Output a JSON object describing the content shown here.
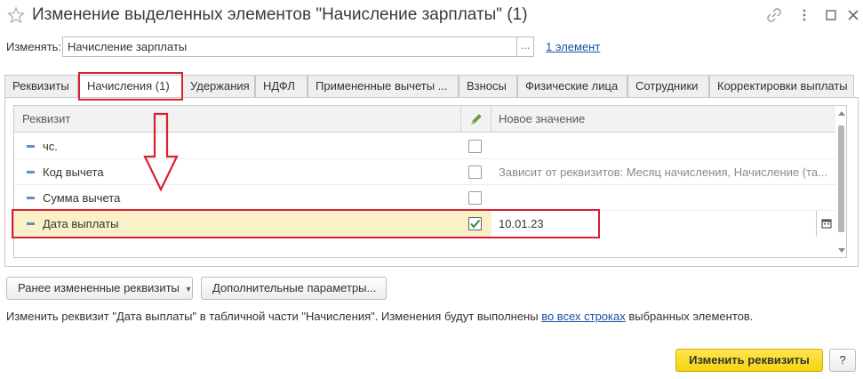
{
  "window": {
    "title": "Изменение выделенных элементов \"Начисление зарплаты\" (1)",
    "star_icon": "star-icon",
    "link_icon": "link-icon",
    "more_icon": "more-icon",
    "maximize_icon": "maximize-icon",
    "close_icon": "close-icon"
  },
  "change": {
    "label": "Изменять:",
    "value": "Начисление зарплаты",
    "select_label": "...",
    "elements_link": "1 элемент"
  },
  "tabs": [
    {
      "label": "Реквизиты"
    },
    {
      "label": "Начисления (1)"
    },
    {
      "label": "Удержания"
    },
    {
      "label": "НДФЛ"
    },
    {
      "label": "Примененные вычеты ..."
    },
    {
      "label": "Взносы"
    },
    {
      "label": "Физические лица"
    },
    {
      "label": "Сотрудники"
    },
    {
      "label": "Корректировки выплаты"
    }
  ],
  "table": {
    "headers": {
      "property": "Реквизит",
      "new_value": "Новое значение",
      "edit_icon": "pencil-icon"
    },
    "rows": [
      {
        "label": "чс.",
        "checked": false,
        "value": ""
      },
      {
        "label": "Код вычета",
        "checked": false,
        "value": "Зависит от реквизитов: Месяц начисления, Начисление (та..."
      },
      {
        "label": "Сумма вычета",
        "checked": false,
        "value": ""
      },
      {
        "label": "Дата выплаты",
        "checked": true,
        "value": "10.01.23"
      }
    ]
  },
  "buttons": {
    "previous_changed": "Ранее измененные реквизиты",
    "previous_changed_arrow": "▾",
    "extra_params": "Дополнительные параметры...",
    "apply": "Изменить реквизиты",
    "help": "?"
  },
  "info": {
    "text_before": "Изменить реквизит \"Дата выплаты\" в табличной части \"Начисления\". Изменения будут выполнены ",
    "link": "во всех строках",
    "text_after": " выбранных элементов."
  },
  "colors": {
    "accent_yellow": "#f5d410",
    "selected_row": "#fbf1c8",
    "annotation_red": "#d8202e",
    "link_blue": "#1b4fa4"
  }
}
